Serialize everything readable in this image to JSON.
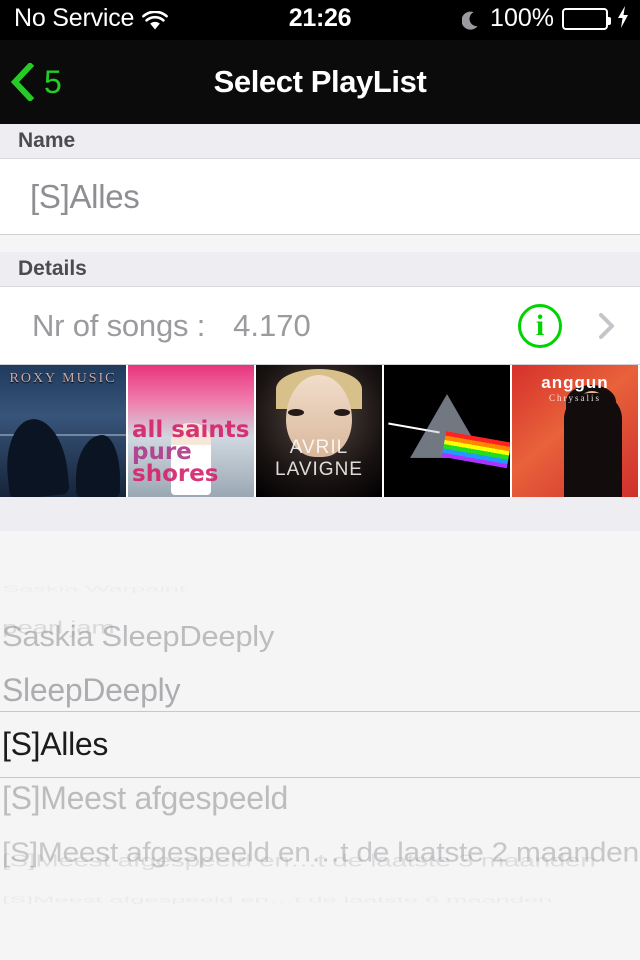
{
  "status_bar": {
    "carrier": "No Service",
    "wifi_icon": "wifi-icon",
    "time": "21:26",
    "dnd_icon": "moon-icon",
    "battery_percent": "100%",
    "battery_icon": "battery-icon",
    "charging_icon": "lightning-bolt-icon",
    "battery_color": "#4cd964"
  },
  "nav_bar": {
    "back_icon": "chevron-left-icon",
    "back_label": "5",
    "title": "Select PlayList",
    "tint_color": "#26cc26",
    "background": "#0b0b0b"
  },
  "sections": [
    {
      "header": "Name",
      "value": "[S]Alles"
    },
    {
      "header": "Details",
      "row_label": "Nr of songs :",
      "row_value": "4.170",
      "info_icon": "info-circle-icon",
      "info_color": "#00d400",
      "disclosure_icon": "chevron-right-icon"
    }
  ],
  "artwork": [
    {
      "name": "artwork-roxy-music",
      "title": "ROXY MUSIC",
      "subtitle": ""
    },
    {
      "name": "artwork-all-saints",
      "line1": "all saints",
      "line2": "pure",
      "line3": "shores"
    },
    {
      "name": "artwork-avril-lavigne",
      "wordmark": "AVRIL LAVIGNE"
    },
    {
      "name": "artwork-pink-floyd",
      "wordmark": ""
    },
    {
      "name": "artwork-anggun",
      "artist": "anggun",
      "album": "Chrysalis"
    }
  ],
  "picker": {
    "selected_index": 4,
    "items": [
      {
        "label": "Saskia Warpaint",
        "opacity": 0.08,
        "scale_y": 0.3,
        "font_size": 26
      },
      {
        "label": "pearl jam",
        "opacity": 0.3,
        "scale_y": 0.62,
        "font_size": 28
      },
      {
        "label": "Saskia SleepDeeply",
        "opacity": 0.62,
        "scale_y": 0.92,
        "font_size": 31
      },
      {
        "label": "SleepDeeply",
        "opacity": 0.78,
        "scale_y": 1.0,
        "font_size": 32
      },
      {
        "label": "[S]Alles",
        "opacity": 1.0,
        "scale_y": 1.0,
        "font_size": 32
      },
      {
        "label": "[S]Meest afgespeeld",
        "opacity": 0.62,
        "scale_y": 1.0,
        "font_size": 32
      },
      {
        "label": "[S]Meest afgespeeld en…t de laatste 2 maanden",
        "opacity": 0.5,
        "scale_y": 0.92,
        "font_size": 30
      },
      {
        "label": "[S]Meest afgespeeld en…t de laatste 3 maanden",
        "opacity": 0.26,
        "scale_y": 0.62,
        "font_size": 28
      },
      {
        "label": "[S]Meest afgespeeld en…t de laatste 6 maanden",
        "opacity": 0.1,
        "scale_y": 0.3,
        "font_size": 26
      }
    ]
  }
}
